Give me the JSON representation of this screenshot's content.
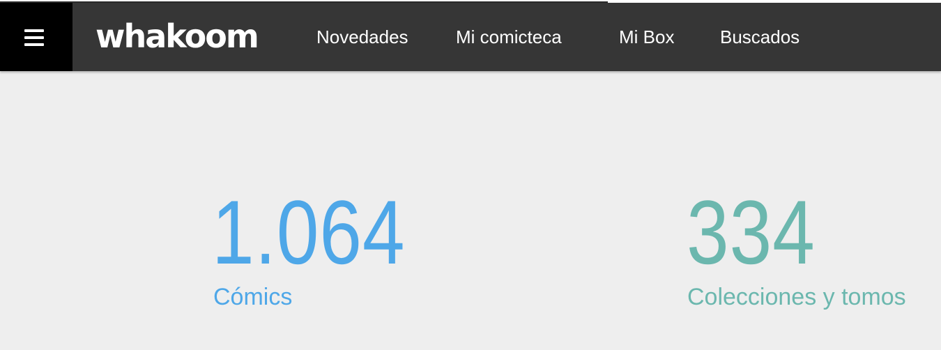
{
  "header": {
    "menu_icon": "hamburger-menu-icon",
    "logo_text": "whakoom",
    "nav": [
      {
        "label": "Novedades"
      },
      {
        "label": "Mi comicteca"
      },
      {
        "label": "Mi Box"
      },
      {
        "label": "Buscados"
      }
    ]
  },
  "stats": {
    "comics": {
      "value": "1.064",
      "label": "Cómics",
      "color": "#4ea7e8"
    },
    "collections": {
      "value": "334",
      "label": "Colecciones y tomos",
      "color": "#6bb7ae"
    }
  },
  "colors": {
    "navbar": "#363636",
    "menu_button": "#000000",
    "background": "#eeeeee"
  }
}
